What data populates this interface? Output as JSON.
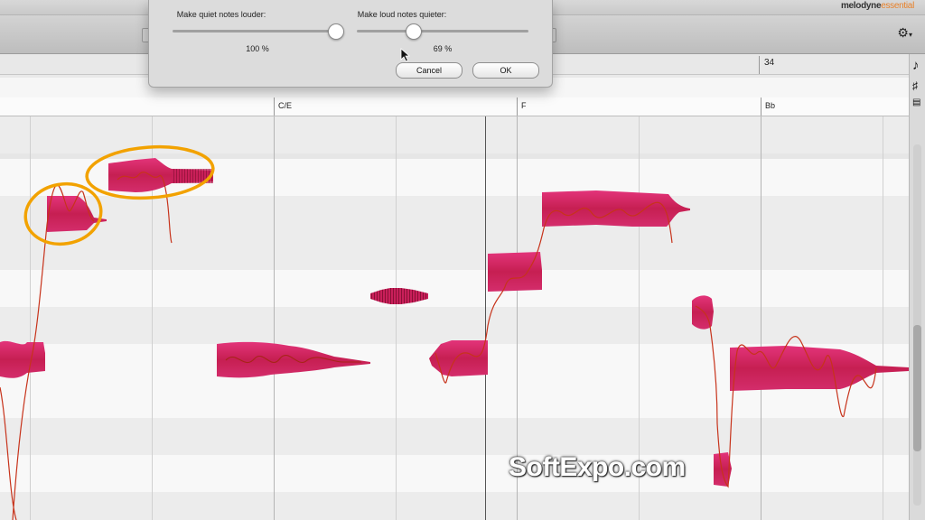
{
  "app": {
    "brand": "melodyne",
    "edition": "essential"
  },
  "ruler": {
    "bar_number": "34"
  },
  "chords": [
    {
      "label": "C/E"
    },
    {
      "label": "F"
    },
    {
      "label": "Bb"
    }
  ],
  "dialog": {
    "quiet_label": "Make quiet notes louder:",
    "quiet_value": "100 %",
    "quiet_level_percent": 100,
    "loud_label": "Make loud notes quieter:",
    "loud_value": "69 %",
    "loud_level_percent": 69,
    "cancel_label": "Cancel",
    "ok_label": "OK"
  },
  "icons": {
    "settings": "gear-icon",
    "note_tool": "note-icon",
    "sharp_tool": "sharp-icon",
    "chord_tool": "chord-icon",
    "cursor": "arrow-cursor-icon"
  },
  "colors": {
    "note_blob": "#d1245f",
    "pitch_curve": "#c7331b",
    "selection_ring": "#f2a200",
    "logo_accent": "#e8812a"
  },
  "watermark": {
    "text": "SoftExpo.com"
  }
}
